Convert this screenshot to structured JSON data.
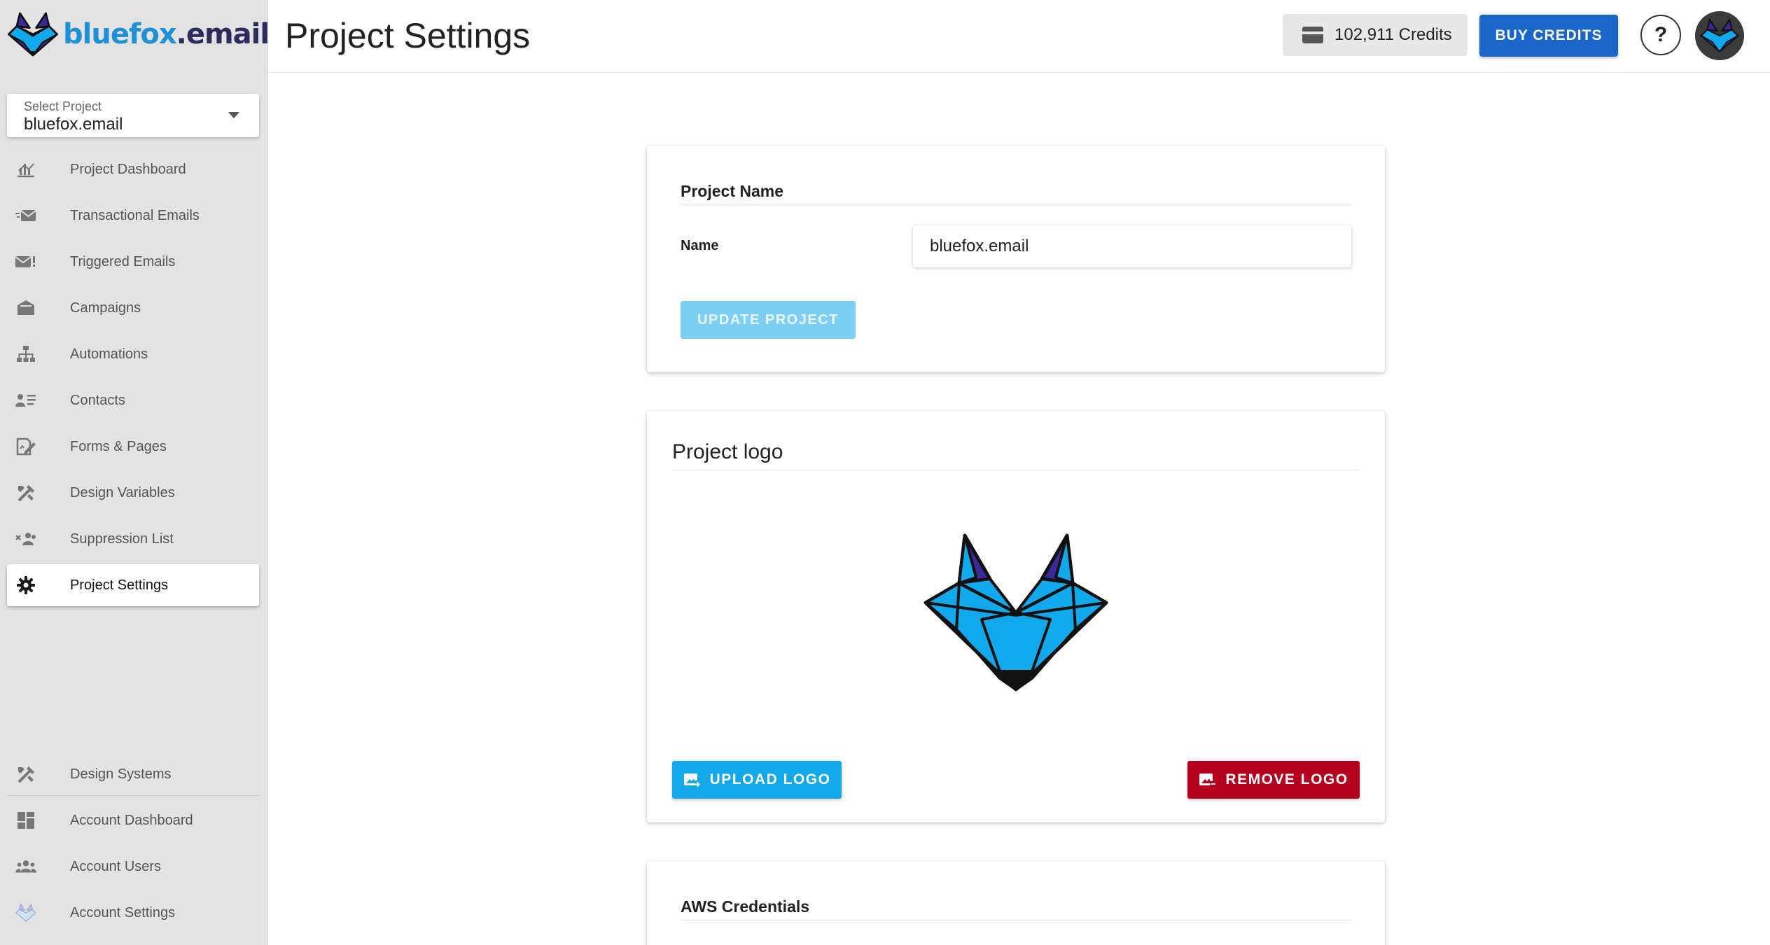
{
  "brand": {
    "name_main": "bluefox",
    "name_dot": ".",
    "name_ext": "email"
  },
  "project_select": {
    "label": "Select Project",
    "value": "bluefox.email"
  },
  "sidebar": {
    "items": [
      {
        "label": "Project Dashboard",
        "icon": "chart-icon"
      },
      {
        "label": "Transactional Emails",
        "icon": "fast-mail-icon"
      },
      {
        "label": "Triggered Emails",
        "icon": "mail-alert-icon"
      },
      {
        "label": "Campaigns",
        "icon": "mailbox-icon"
      },
      {
        "label": "Automations",
        "icon": "sitemap-icon"
      },
      {
        "label": "Contacts",
        "icon": "contacts-list-icon"
      },
      {
        "label": "Forms & Pages",
        "icon": "form-edit-icon"
      },
      {
        "label": "Design Variables",
        "icon": "design-tools-icon"
      },
      {
        "label": "Suppression List",
        "icon": "users-blocked-icon"
      },
      {
        "label": "Project Settings",
        "icon": "gear-icon",
        "active": true
      }
    ],
    "bottom_items": [
      {
        "label": "Design Systems",
        "icon": "design-tools-icon"
      },
      {
        "label": "Account Dashboard",
        "icon": "dashboard-icon"
      },
      {
        "label": "Account Users",
        "icon": "users-icon"
      },
      {
        "label": "Account Settings",
        "icon": "fox-settings-icon"
      }
    ]
  },
  "header": {
    "title": "Project Settings",
    "credits": "102,911 Credits",
    "buy_label": "BUY CREDITS",
    "help_label": "?"
  },
  "project_name_card": {
    "heading": "Project Name",
    "name_label": "Name",
    "name_value": "bluefox.email",
    "update_label": "UPDATE PROJECT"
  },
  "logo_card": {
    "heading": "Project logo",
    "upload_label": "UPLOAD LOGO",
    "remove_label": "REMOVE LOGO"
  },
  "aws_card": {
    "heading": "AWS Credentials"
  },
  "colors": {
    "primary": "#1a66c9",
    "upload": "#14a8e8",
    "danger": "#b3001f",
    "disabled": "#7dcff3",
    "fox_blue": "#12a9ec",
    "fox_purple": "#3b2a9a"
  }
}
